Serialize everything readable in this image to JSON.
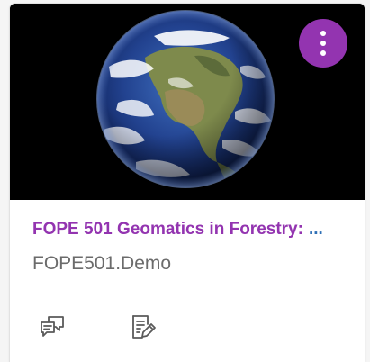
{
  "card": {
    "title": "FOPE 501 Geomatics in Forestry:",
    "title_ellipsis": "...",
    "code": "FOPE501.Demo",
    "hero_image": "earth-globe-image",
    "options_icon": "kebab-menu-icon",
    "actions": [
      {
        "icon": "discussions-icon"
      },
      {
        "icon": "assignments-icon"
      }
    ]
  },
  "colors": {
    "accent": "#9334b0",
    "link_ellipsis": "#2d6fb6",
    "secondary_text": "#6b6b6b",
    "hero_background": "#000000"
  }
}
